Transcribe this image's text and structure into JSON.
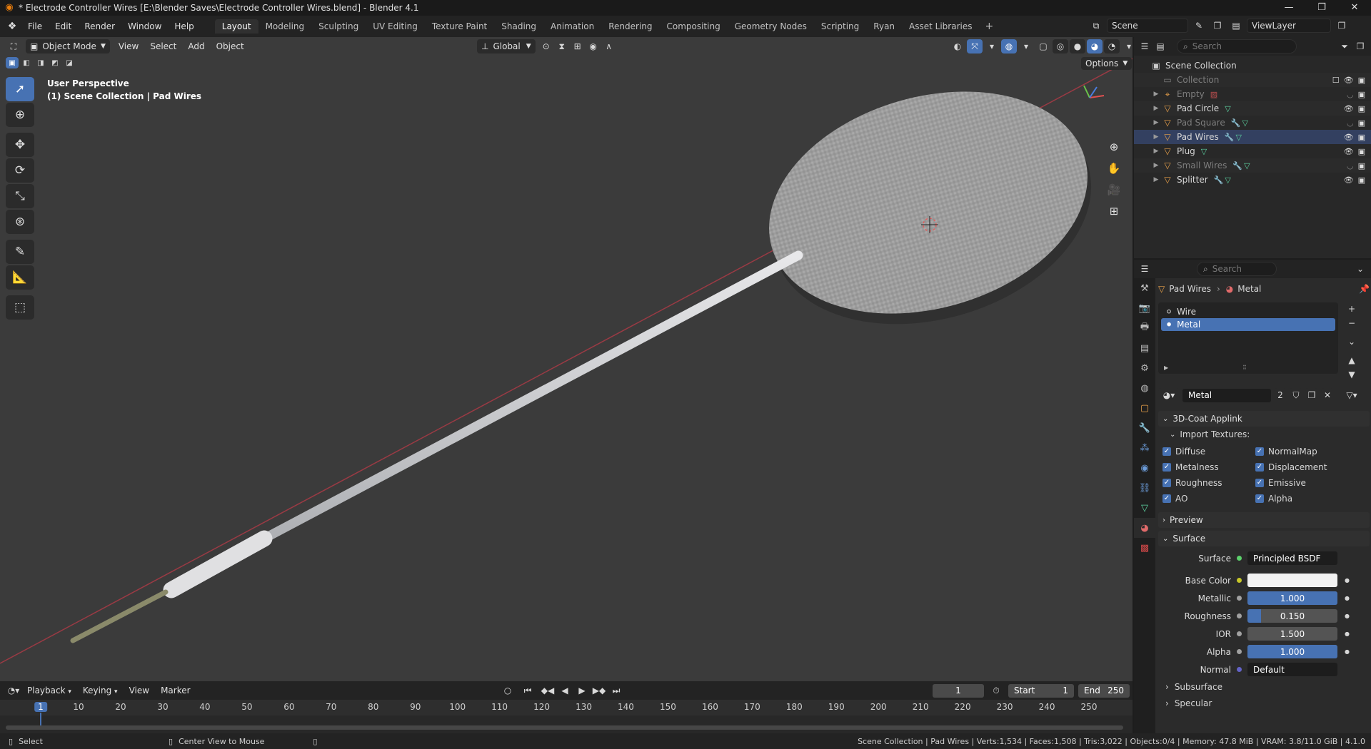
{
  "titlebar": {
    "title": "* Electrode Controller Wires [E:\\Blender Saves\\Electrode Controller Wires.blend] - Blender 4.1",
    "minimize": "—",
    "maximize": "❐",
    "close": "✕"
  },
  "menu": {
    "items": [
      "File",
      "Edit",
      "Render",
      "Window",
      "Help"
    ]
  },
  "workspaces": {
    "tabs": [
      "Layout",
      "Modeling",
      "Sculpting",
      "UV Editing",
      "Texture Paint",
      "Shading",
      "Animation",
      "Rendering",
      "Compositing",
      "Geometry Nodes",
      "Scripting",
      "Ryan",
      "Asset Libraries"
    ],
    "active": "Layout",
    "add": "+"
  },
  "scene": {
    "name": "Scene",
    "view_layer": "ViewLayer"
  },
  "viewport": {
    "mode": "Object Mode",
    "menus": [
      "View",
      "Select",
      "Add",
      "Object"
    ],
    "orientation": "Global",
    "options_label": "Options",
    "perspective_label": "User Perspective",
    "context_label": "(1) Scene Collection | Pad Wires"
  },
  "outliner": {
    "search_placeholder": "Search",
    "root": "Scene Collection",
    "collection": "Collection",
    "objects": [
      {
        "name": "Empty",
        "visible": false
      },
      {
        "name": "Pad Circle",
        "visible": true
      },
      {
        "name": "Pad Square",
        "visible": false
      },
      {
        "name": "Pad Wires",
        "visible": true
      },
      {
        "name": "Plug",
        "visible": true
      },
      {
        "name": "Small Wires",
        "visible": false
      },
      {
        "name": "Splitter",
        "visible": true
      }
    ]
  },
  "properties": {
    "search_placeholder": "Search",
    "breadcrumb_object": "Pad Wires",
    "breadcrumb_material": "Metal",
    "slots": [
      "Wire",
      "Metal"
    ],
    "selected_slot": "Metal",
    "material_name": "Metal",
    "users": "2",
    "applink_panel": "3D-Coat Applink",
    "import_textures": "Import Textures:",
    "textures_left": [
      "Diffuse",
      "Metalness",
      "Roughness",
      "AO"
    ],
    "textures_right": [
      "NormalMap",
      "Displacement",
      "Emissive",
      "Alpha"
    ],
    "preview_panel": "Preview",
    "surface_panel": "Surface",
    "surface_label": "Surface",
    "surface_value": "Principled BSDF",
    "base_color_label": "Base Color",
    "base_color": "#f2f2f2",
    "metallic_label": "Metallic",
    "metallic_value": "1.000",
    "metallic": 1.0,
    "roughness_label": "Roughness",
    "roughness_value": "0.150",
    "roughness": 0.15,
    "ior_label": "IOR",
    "ior_value": "1.500",
    "alpha_label": "Alpha",
    "alpha_value": "1.000",
    "alpha": 1.0,
    "normal_label": "Normal",
    "normal_value": "Default",
    "subsurface_panel": "Subsurface",
    "specular_panel": "Specular"
  },
  "timeline": {
    "menus": [
      "Playback",
      "Keying",
      "View",
      "Marker"
    ],
    "current_frame": "1",
    "start_label": "Start",
    "start_value": "1",
    "end_label": "End",
    "end_value": "250",
    "ticks": [
      "1",
      "10",
      "20",
      "30",
      "40",
      "50",
      "60",
      "70",
      "80",
      "90",
      "100",
      "110",
      "120",
      "130",
      "140",
      "150",
      "160",
      "170",
      "180",
      "190",
      "200",
      "210",
      "220",
      "230",
      "240",
      "250"
    ]
  },
  "statusbar": {
    "select": "Select",
    "center_view": "Center View to Mouse",
    "info": "Scene Collection | Pad Wires | Verts:1,534 | Faces:1,508 | Tris:3,022 | Objects:0/4 | Memory: 47.8 MiB | VRAM: 3.8/11.0 GiB | 4.1.0"
  },
  "colors": {
    "accent": "#4772b3",
    "viewport_bg": "#3b3b3b",
    "object_orange": "#e8a04a",
    "modifier_blue": "#6b9bd8",
    "mesh_green": "#5cd1a0"
  }
}
